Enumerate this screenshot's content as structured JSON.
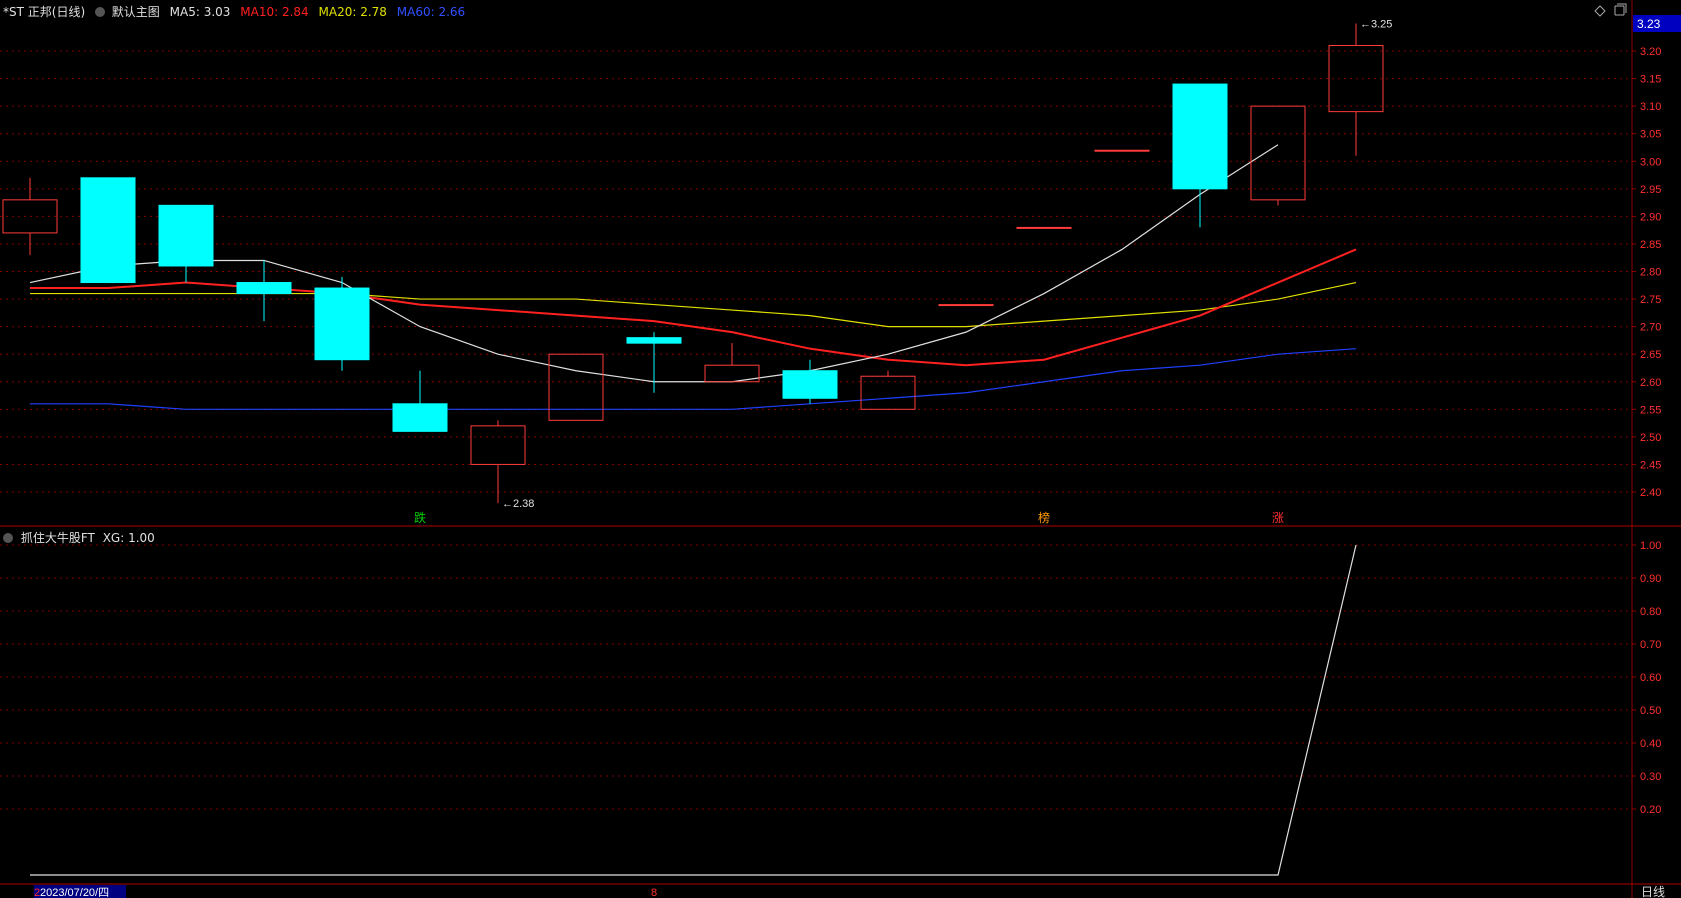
{
  "header": {
    "stock": "*ST 正邦(日线)",
    "menu_label": "默认主图",
    "ma5": "MA5: 3.03",
    "ma10": "MA10: 2.84",
    "ma20": "MA20: 2.78",
    "ma60": "MA60: 2.66"
  },
  "sub_header": {
    "label": "抓住大牛股FT",
    "xg": "XG: 1.00"
  },
  "price_tag": "3.23",
  "period_label": "日线",
  "date_label": "2023/07/20/四",
  "date_prefix": "2",
  "bottom_marker": "8",
  "markers": [
    {
      "label": "跌",
      "index": 5,
      "color": "#00d000"
    },
    {
      "label": "榜",
      "index": 13,
      "color": "#ff9900"
    },
    {
      "label": "涨",
      "index": 16,
      "color": "#ff3030"
    }
  ],
  "colors": {
    "up": "#ff3b3b",
    "down": "#00ffff",
    "ma5": "#e0e0e0",
    "ma10": "#ff2020",
    "ma20": "#e0e000",
    "ma60": "#2040ff",
    "grid": "#800000"
  },
  "chart_data": [
    {
      "type": "candlestick",
      "y_ticks": [
        "3.20",
        "3.15",
        "3.10",
        "3.05",
        "3.00",
        "2.95",
        "2.90",
        "2.85",
        "2.80",
        "2.75",
        "2.70",
        "2.65",
        "2.60",
        "2.55",
        "2.50",
        "2.45",
        "2.40"
      ],
      "ylim": [
        2.36,
        3.26
      ],
      "candles": [
        {
          "o": 2.87,
          "c": 2.93,
          "h": 2.97,
          "l": 2.83
        },
        {
          "o": 2.97,
          "c": 2.78,
          "h": 2.97,
          "l": 2.78
        },
        {
          "o": 2.92,
          "c": 2.81,
          "h": 2.92,
          "l": 2.78
        },
        {
          "o": 2.78,
          "c": 2.76,
          "h": 2.82,
          "l": 2.71
        },
        {
          "o": 2.77,
          "c": 2.64,
          "h": 2.79,
          "l": 2.62
        },
        {
          "o": 2.56,
          "c": 2.51,
          "h": 2.62,
          "l": 2.51
        },
        {
          "o": 2.45,
          "c": 2.52,
          "h": 2.53,
          "l": 2.38
        },
        {
          "o": 2.53,
          "c": 2.65,
          "h": 2.65,
          "l": 2.53
        },
        {
          "o": 2.68,
          "c": 2.67,
          "h": 2.69,
          "l": 2.58
        },
        {
          "o": 2.6,
          "c": 2.63,
          "h": 2.67,
          "l": 2.6
        },
        {
          "o": 2.62,
          "c": 2.57,
          "h": 2.64,
          "l": 2.56
        },
        {
          "o": 2.55,
          "c": 2.61,
          "h": 2.62,
          "l": 2.55
        },
        {
          "o": 2.74,
          "c": 2.74,
          "h": 2.74,
          "l": 2.74
        },
        {
          "o": 2.88,
          "c": 2.88,
          "h": 2.88,
          "l": 2.88
        },
        {
          "o": 3.02,
          "c": 3.02,
          "h": 3.02,
          "l": 3.02
        },
        {
          "o": 3.14,
          "c": 2.95,
          "h": 3.14,
          "l": 2.88
        },
        {
          "o": 2.93,
          "c": 3.1,
          "h": 3.1,
          "l": 2.92
        },
        {
          "o": 3.09,
          "c": 3.21,
          "h": 3.25,
          "l": 3.01
        }
      ],
      "ma5": [
        2.78,
        2.81,
        2.82,
        2.82,
        2.78,
        2.7,
        2.65,
        2.62,
        2.6,
        2.6,
        2.62,
        2.65,
        2.69,
        2.76,
        2.84,
        2.94,
        3.03
      ],
      "ma10": [
        2.77,
        2.77,
        2.78,
        2.77,
        2.76,
        2.74,
        2.73,
        2.72,
        2.71,
        2.69,
        2.66,
        2.64,
        2.63,
        2.64,
        2.68,
        2.72,
        2.78,
        2.84
      ],
      "ma20": [
        2.76,
        2.76,
        2.76,
        2.76,
        2.76,
        2.75,
        2.75,
        2.75,
        2.74,
        2.73,
        2.72,
        2.7,
        2.7,
        2.71,
        2.72,
        2.73,
        2.75,
        2.78
      ],
      "ma60": [
        2.56,
        2.56,
        2.55,
        2.55,
        2.55,
        2.55,
        2.55,
        2.55,
        2.55,
        2.55,
        2.56,
        2.57,
        2.58,
        2.6,
        2.62,
        2.63,
        2.65,
        2.66
      ],
      "annotations": [
        {
          "label": "3.25",
          "index": 17,
          "value": 3.25
        },
        {
          "label": "2.38",
          "index": 6,
          "value": 2.38
        }
      ]
    },
    {
      "type": "line",
      "title": "抓住大牛股FT",
      "y_ticks": [
        "1.00",
        "0.90",
        "0.80",
        "0.70",
        "0.60",
        "0.50",
        "0.40",
        "0.30",
        "0.20"
      ],
      "ylim": [
        0,
        1.0
      ],
      "series": [
        {
          "name": "XG",
          "values": [
            0,
            0,
            0,
            0,
            0,
            0,
            0,
            0,
            0,
            0,
            0,
            0,
            0,
            0,
            0,
            0,
            0,
            1.0
          ]
        }
      ]
    }
  ]
}
